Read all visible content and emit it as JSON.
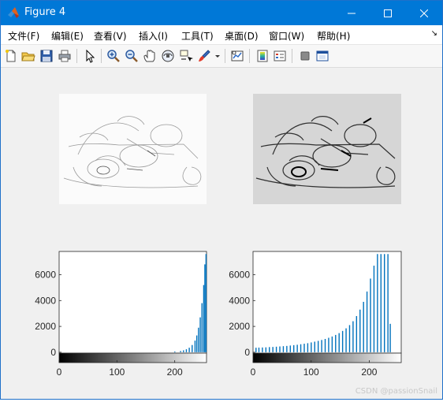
{
  "window": {
    "title": "Figure 4"
  },
  "menu": [
    {
      "label": "文件(F)"
    },
    {
      "label": "编辑(E)"
    },
    {
      "label": "查看(V)"
    },
    {
      "label": "插入(I)"
    },
    {
      "label": "工具(T)"
    },
    {
      "label": "桌面(D)"
    },
    {
      "label": "窗口(W)"
    },
    {
      "label": "帮助(H)"
    }
  ],
  "toolbar": {
    "icons": [
      "new-figure-icon",
      "open-file-icon",
      "save-icon",
      "print-icon",
      "select-arrow-icon",
      "zoom-in-icon",
      "zoom-out-icon",
      "pan-icon",
      "rotate-3d-icon",
      "data-cursor-icon",
      "brush-icon",
      "brush-dropdown-icon",
      "link-plot-icon",
      "colorbar-icon",
      "legend-icon",
      "hide-plot-tools-icon",
      "show-plot-tools-icon"
    ]
  },
  "chart_data": [
    {
      "type": "image",
      "description_free": true
    },
    {
      "type": "image"
    },
    {
      "type": "bar",
      "xlim": [
        0,
        255
      ],
      "ylim": [
        -800,
        7800
      ],
      "xticks": [
        0,
        100,
        200
      ],
      "yticks": [
        0,
        2000,
        4000,
        6000
      ],
      "x": [
        200,
        210,
        215,
        220,
        225,
        230,
        235,
        238,
        241,
        244,
        247,
        250,
        252,
        254
      ],
      "values": [
        60,
        100,
        150,
        230,
        350,
        560,
        900,
        1300,
        1900,
        2700,
        3800,
        5200,
        6800,
        7600
      ]
    },
    {
      "type": "bar",
      "xlim": [
        0,
        255
      ],
      "ylim": [
        -800,
        7800
      ],
      "xticks": [
        0,
        100,
        200
      ],
      "yticks": [
        0,
        2000,
        4000,
        6000
      ],
      "x": [
        5,
        10,
        16,
        22,
        28,
        34,
        40,
        46,
        52,
        58,
        64,
        70,
        76,
        82,
        88,
        94,
        100,
        106,
        112,
        118,
        124,
        130,
        136,
        142,
        148,
        154,
        160,
        166,
        172,
        178,
        184,
        190,
        196,
        202,
        208,
        214,
        220,
        226,
        232,
        236
      ],
      "values": [
        350,
        360,
        370,
        380,
        400,
        410,
        430,
        450,
        470,
        490,
        520,
        550,
        580,
        620,
        660,
        700,
        760,
        820,
        880,
        950,
        1030,
        1120,
        1220,
        1340,
        1480,
        1650,
        1850,
        2100,
        2400,
        2800,
        3300,
        3900,
        4700,
        5700,
        6700,
        7600,
        7600,
        7600,
        7600,
        2200
      ]
    }
  ],
  "watermark": "CSDN @passionSnail"
}
